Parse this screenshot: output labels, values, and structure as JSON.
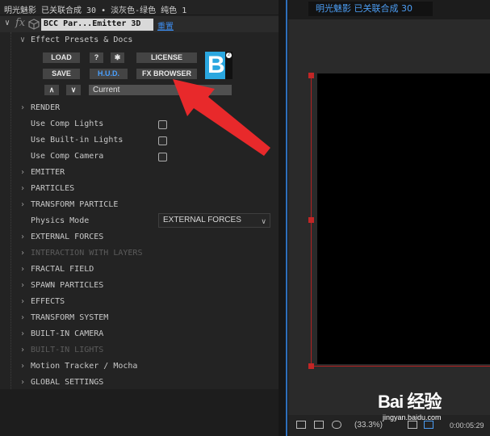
{
  "left_panel": {
    "title": "明光魅影 已关联合成 30 • 淡灰色-绿色 纯色 1",
    "effect_name": "BCC Par...Emitter 3D",
    "reset_label": "重置",
    "presets_label": "Effect Presets & Docs",
    "buttons": {
      "load": "LOAD",
      "help": "?",
      "settings_icon": "gear-icon",
      "license": "LICENSE",
      "save": "SAVE",
      "hud": "H.U.D.",
      "fx_browser": "FX BROWSER",
      "prev_icon": "chevron-up-icon",
      "next_icon": "chevron-down-icon",
      "preset_current": "Current"
    },
    "properties": [
      {
        "label": "RENDER",
        "type": "group"
      },
      {
        "label": "Use Comp Lights",
        "type": "checkbox",
        "checked": false
      },
      {
        "label": "Use Built-in Lights",
        "type": "checkbox",
        "checked": false
      },
      {
        "label": "Use Comp Camera",
        "type": "checkbox",
        "checked": false
      },
      {
        "label": "EMITTER",
        "type": "group"
      },
      {
        "label": "PARTICLES",
        "type": "group"
      },
      {
        "label": "TRANSFORM PARTICLE",
        "type": "group"
      },
      {
        "label": "Physics Mode",
        "type": "dropdown",
        "value": "EXTERNAL FORCES"
      },
      {
        "label": "EXTERNAL FORCES",
        "type": "group"
      },
      {
        "label": "INTERACTION WITH LAYERS",
        "type": "group",
        "disabled": true
      },
      {
        "label": "FRACTAL FIELD",
        "type": "group"
      },
      {
        "label": "SPAWN PARTICLES",
        "type": "group"
      },
      {
        "label": "EFFECTS",
        "type": "group"
      },
      {
        "label": "TRANSFORM SYSTEM",
        "type": "group"
      },
      {
        "label": "BUILT-IN CAMERA",
        "type": "group"
      },
      {
        "label": "BUILT-IN LIGHTS",
        "type": "group",
        "disabled": true
      },
      {
        "label": "Motion Tracker / Mocha",
        "type": "group"
      },
      {
        "label": "GLOBAL SETTINGS",
        "type": "group"
      }
    ]
  },
  "right_panel": {
    "tab_label": "明光魅影 已关联合成 30",
    "zoom": "(33.3%)",
    "timecode": "0:00:05:29"
  },
  "watermark": {
    "logo": "Bai 经验",
    "url": "jingyan.baidu.com"
  },
  "colors": {
    "accent_blue": "#4c9df3",
    "annotation_red": "#e8292b",
    "selection_red": "#c22626"
  }
}
